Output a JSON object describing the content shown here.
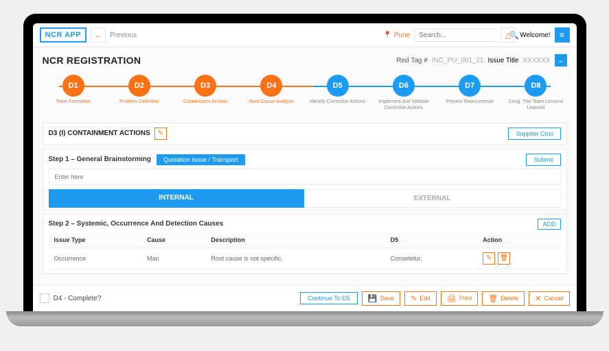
{
  "app": {
    "logo": "NCR APP",
    "previous": "Previous",
    "location": "Pune",
    "search_placeholder": "Search...",
    "welcome": "Welcome!"
  },
  "page": {
    "title": "NCR REGISTRATION",
    "red_tag_label": "Red Tag #",
    "red_tag_value": "INC_PU_001_21",
    "issue_title_label": "Issue Title",
    "issue_title_value": "XXXXXX"
  },
  "steps": [
    {
      "code": "D1",
      "label": "Team Formation"
    },
    {
      "code": "D2",
      "label": "Problem Definition"
    },
    {
      "code": "D3",
      "label": "Containment Actions"
    },
    {
      "code": "D4",
      "label": "Root Cause Analysis"
    },
    {
      "code": "D5",
      "label": "Identify Corrective Actions"
    },
    {
      "code": "D6",
      "label": "Implement And Validate Corrective Actions"
    },
    {
      "code": "D7",
      "label": "Prevent Reoccurrence"
    },
    {
      "code": "D8",
      "label": "Cong. The Team Lessons Learned"
    }
  ],
  "section": {
    "heading": "D3 (I) CONTAINMENT ACTIONS",
    "supplier_cost": "Supplier Cost",
    "step1_label": "Step 1 – General Brainstorming",
    "quotation_btn": "Quotation Issue / Transport",
    "submit": "Submit",
    "enter_placeholder": "Enter here",
    "tab_internal": "INTERNAL",
    "tab_external": "EXTERNAL",
    "step2_label": "Step 2 – Systemic, Occurrence And Detection Causes",
    "add": "ADD"
  },
  "table": {
    "headers": {
      "issue_type": "Issue Type",
      "cause": "Cause",
      "description": "Description",
      "d5": "D5",
      "action": "Action"
    },
    "row": {
      "issue_type": "Occurrence",
      "cause": "Man",
      "description": "Root cause is not specific.",
      "d5": "Consetetur."
    }
  },
  "footer": {
    "complete_label": "D4 - Complete?",
    "continue_btn": "Continue To D5",
    "save": "Save",
    "edit": "Edit",
    "print": "Print",
    "delete": "Delete",
    "cancel": "Cancel"
  }
}
